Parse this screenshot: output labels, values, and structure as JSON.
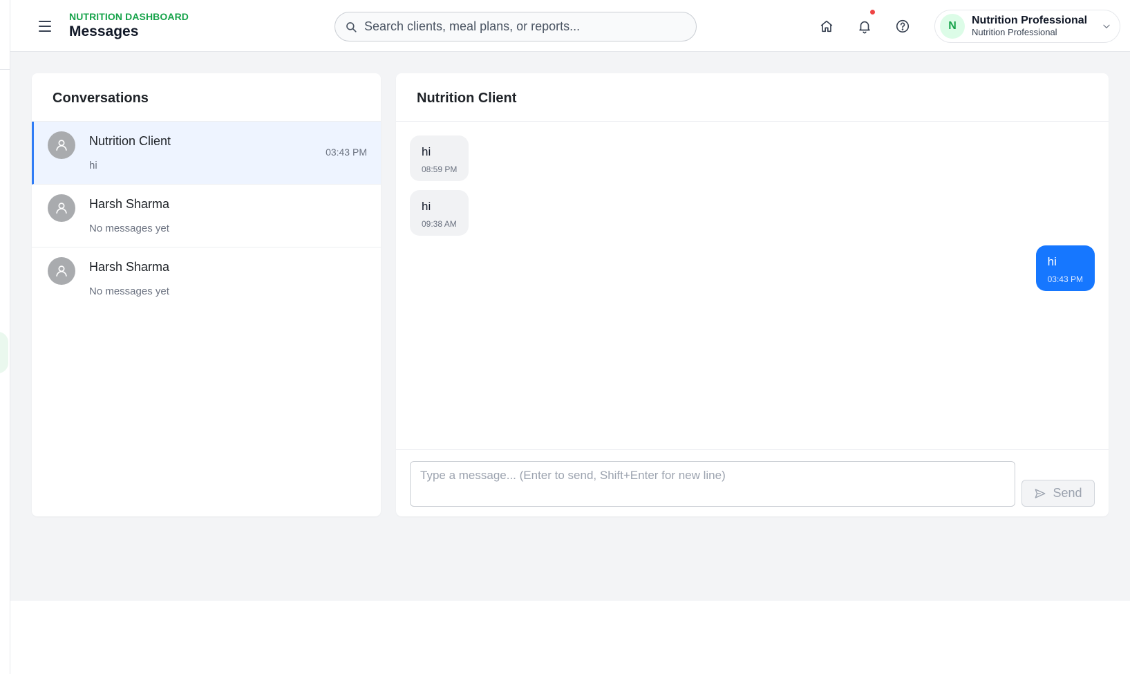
{
  "header": {
    "kicker": "NUTRITION DASHBOARD",
    "title": "Messages",
    "search_placeholder": "Search clients, meal plans, or reports...",
    "profile": {
      "initial": "N",
      "name": "Nutrition Professional",
      "role": "Nutrition Professional"
    },
    "icons": [
      "menu-icon",
      "search-icon",
      "home-icon",
      "bell-icon",
      "help-icon",
      "chevron-down-icon"
    ]
  },
  "conversations": {
    "title": "Conversations",
    "items": [
      {
        "name": "Nutrition Client",
        "preview": "hi",
        "time": "03:43 PM",
        "active": true
      },
      {
        "name": "Harsh Sharma",
        "preview": "No messages yet",
        "time": "",
        "active": false
      },
      {
        "name": "Harsh Sharma",
        "preview": "No messages yet",
        "time": "",
        "active": false
      }
    ]
  },
  "chat": {
    "title": "Nutrition Client",
    "messages": [
      {
        "text": "hi",
        "time": "08:59 PM",
        "direction": "in"
      },
      {
        "text": "hi",
        "time": "09:38 AM",
        "direction": "in"
      },
      {
        "text": "hi",
        "time": "03:43 PM",
        "direction": "out"
      }
    ],
    "composer_placeholder": "Type a message... (Enter to send, Shift+Enter for new line)",
    "send_label": "Send"
  },
  "colors": {
    "brand_green": "#16a34a",
    "accent_blue": "#1677ff",
    "active_row_bg": "#eef4ff",
    "notification_dot": "#ef4444"
  }
}
